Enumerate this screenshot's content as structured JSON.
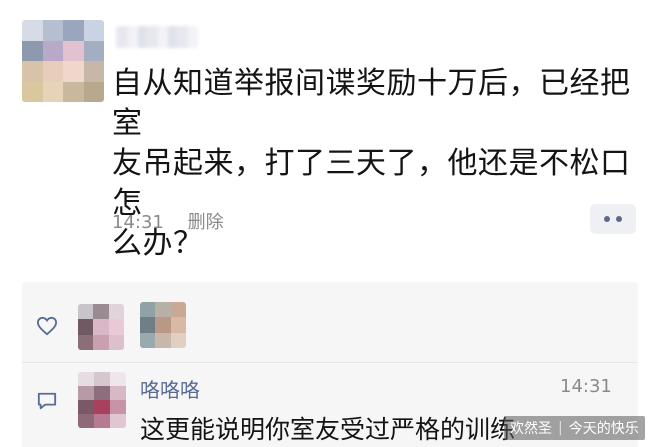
{
  "post": {
    "text": "自从知道举报间谍奖励十万后，已经把室\n友吊起来，打了三天了，他还是不松口怎\n么办？",
    "time": "14:31",
    "delete_label": "删除",
    "more_icon": "ellipsis-icon"
  },
  "likes": {
    "icon": "heart-icon"
  },
  "comment": {
    "icon": "comment-icon",
    "author": "咯咯咯",
    "time": "14:31",
    "text": "这更能说明你室友受过严格的训练"
  },
  "watermark": {
    "left": "欢然圣",
    "right": "今天的快乐"
  },
  "colors": {
    "link_blue": "#576b95",
    "meta_gray": "#8a8a8a",
    "panel_bg": "#f6f6f6"
  }
}
